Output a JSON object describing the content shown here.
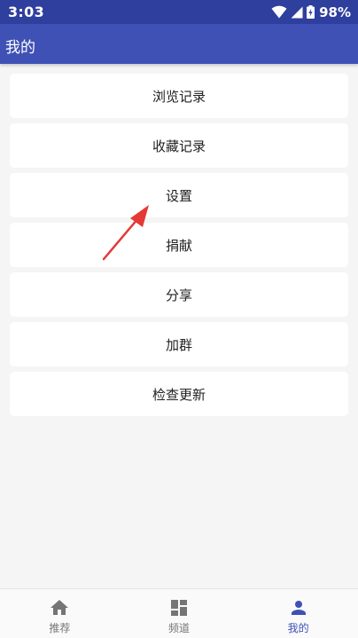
{
  "status_bar": {
    "time": "3:03",
    "battery": "98%",
    "icons": [
      "wifi-icon",
      "cellular-signal-icon",
      "battery-icon"
    ]
  },
  "app_bar": {
    "title": "我的"
  },
  "menu": {
    "items": [
      {
        "label": "浏览记录"
      },
      {
        "label": "收藏记录"
      },
      {
        "label": "设置"
      },
      {
        "label": "捐献"
      },
      {
        "label": "分享"
      },
      {
        "label": "加群"
      },
      {
        "label": "检查更新"
      }
    ]
  },
  "annotation": {
    "type": "arrow",
    "color": "#e53935",
    "points_to": "设置"
  },
  "bottom_nav": {
    "items": [
      {
        "label": "推荐",
        "icon": "home-icon",
        "active": false
      },
      {
        "label": "频道",
        "icon": "dashboard-icon",
        "active": false
      },
      {
        "label": "我的",
        "icon": "person-icon",
        "active": true
      }
    ],
    "active_color": "#3f51b5",
    "inactive_color": "#757575"
  },
  "colors": {
    "status_bar": "#2f3f9e",
    "app_bar": "#3f51b5",
    "background": "#f5f5f5"
  }
}
